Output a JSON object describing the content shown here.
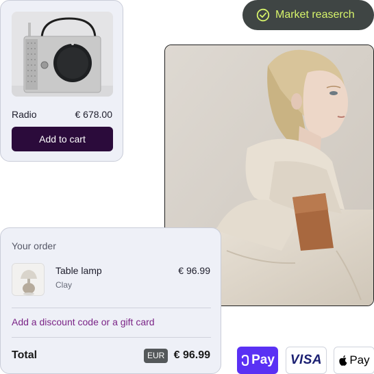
{
  "product_card": {
    "name": "Radio",
    "price": "€ 678.00",
    "add_to_cart_label": "Add to cart",
    "image": "radio-product-image"
  },
  "chip": {
    "label": "Market reaserch",
    "icon": "check-circle-icon",
    "text_color": "#d7f46b",
    "bg_color": "#3f4544"
  },
  "photo": {
    "image": "model-in-beige-coat-photo"
  },
  "order": {
    "title": "Your order",
    "item": {
      "name": "Table lamp",
      "variant": "Clay",
      "price": "€ 96.99",
      "image": "table-lamp-thumbnail"
    },
    "discount_link": "Add a discount code or a gift card",
    "total_label": "Total",
    "currency": "EUR",
    "total_amount": "€ 96.99"
  },
  "payments": {
    "shop_pay_label": "Pay",
    "visa_label": "VISA",
    "apple_pay_label": "Pay"
  },
  "colors": {
    "accent_dark": "#2b0b3b",
    "link": "#7a2386",
    "shop_pay": "#5a31f4",
    "card_bg": "#eef0f7"
  }
}
